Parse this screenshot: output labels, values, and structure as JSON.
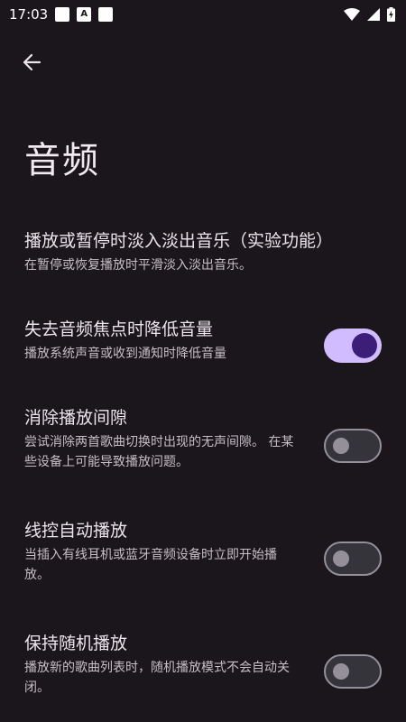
{
  "status_bar": {
    "time": "17:03",
    "notification_icons": [
      "notification-square-icon",
      "a-badge-icon",
      "notification-square-icon"
    ],
    "a_badge_text": "A",
    "right_icons": [
      "wifi-icon",
      "cell-signal-icon",
      "battery-charging-icon"
    ]
  },
  "header": {
    "back_icon": "arrow-back-icon",
    "title": "音频"
  },
  "settings": {
    "items": [
      {
        "title": "播放或暂停时淡入淡出音乐（实验功能）",
        "summary": "在暂停或恢复播放时平滑淡入淡出音乐。",
        "toggle": null
      },
      {
        "title": "失去音频焦点时降低音量",
        "summary": "播放系统声音或收到通知时降低音量",
        "toggle": "on"
      },
      {
        "title": "消除播放间隙",
        "summary": "尝试消除两首歌曲切换时出现的无声间隙。 在某些设备上可能导致播放问题。",
        "toggle": "off"
      },
      {
        "title": "线控自动播放",
        "summary": "当插入有线耳机或蓝牙音频设备时立即开始播放。",
        "toggle": "off"
      },
      {
        "title": "保持随机播放",
        "summary": "播放新的歌曲列表时，随机播放模式不会自动关闭。",
        "toggle": "off"
      }
    ]
  },
  "colors": {
    "background": "#1a161b",
    "switch_on_track": "#d1bcff",
    "switch_on_thumb": "#3c1e78",
    "switch_off_track": "#36343b",
    "switch_off_outline": "#948f99"
  }
}
